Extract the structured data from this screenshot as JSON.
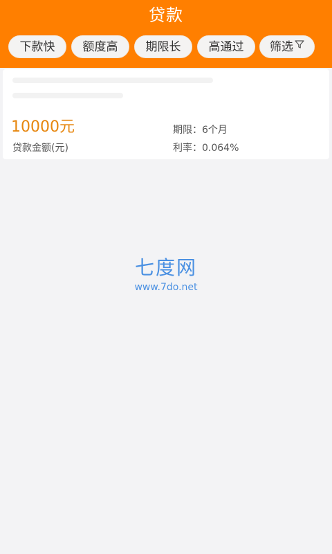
{
  "header": {
    "title": "贷款",
    "background_color": "#ff7f00"
  },
  "filters": [
    {
      "label": "下款快"
    },
    {
      "label": "额度高"
    },
    {
      "label": "期限长"
    },
    {
      "label": "高通过"
    },
    {
      "label": "筛选",
      "icon": "filter-funnel-icon"
    }
  ],
  "loan_card": {
    "amount": "10000元",
    "amount_label": "贷款金额(元)",
    "term": "期限：6个月",
    "rate": "利率：0.064%",
    "amount_color": "#e6860e"
  },
  "watermark": {
    "main": "七度网",
    "sub": "www.7do.net",
    "color": "#4a90e2"
  }
}
